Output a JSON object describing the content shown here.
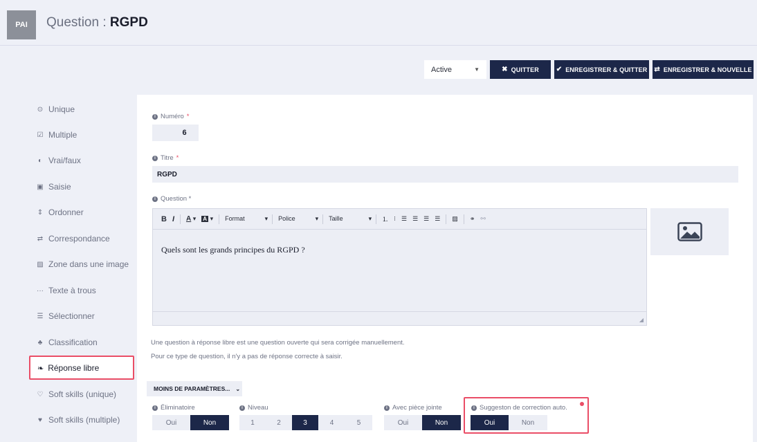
{
  "header": {
    "badge": "PAI",
    "title_prefix": "Question : ",
    "title_name": "RGPD"
  },
  "actions": {
    "status_value": "Active",
    "quit_label": "QUITTER",
    "save_quit_label": "ENREGISTRER & QUITTER",
    "save_new_label": "ENREGISTRER & NOUVELLE"
  },
  "sidebar": {
    "items": [
      {
        "label": "Unique",
        "icon": "radio-icon"
      },
      {
        "label": "Multiple",
        "icon": "checkbox-icon"
      },
      {
        "label": "Vrai/faux",
        "icon": "half-circle-icon"
      },
      {
        "label": "Saisie",
        "icon": "edit-icon"
      },
      {
        "label": "Ordonner",
        "icon": "sort-icon"
      },
      {
        "label": "Correspondance",
        "icon": "swap-icon"
      },
      {
        "label": "Zone dans une image",
        "icon": "image-icon"
      },
      {
        "label": "Texte à trous",
        "icon": "dots-icon"
      },
      {
        "label": "Sélectionner",
        "icon": "list-icon"
      },
      {
        "label": "Classification",
        "icon": "hierarchy-icon"
      },
      {
        "label": "Réponse libre",
        "icon": "leaf-icon"
      },
      {
        "label": "Soft skills (unique)",
        "icon": "heart-outline-icon"
      },
      {
        "label": "Soft skills (multiple)",
        "icon": "heart-icon"
      }
    ],
    "active_index": 10
  },
  "form": {
    "numero_label": "Numéro",
    "numero_value": "6",
    "titre_label": "Titre",
    "titre_value": "RGPD",
    "question_label": "Question *",
    "required_mark": "*",
    "toolbar": {
      "format": "Format",
      "police": "Police",
      "taille": "Taille"
    },
    "question_text": "Quels sont les grands principes du RGPD ?",
    "help_line1": "Une question à réponse libre est une question ouverte qui sera corrigée manuellement.",
    "help_line2": "Pour ce type de question, il n'y a pas de réponse correcte à saisir.",
    "more_params": "MOINS DE PARAMÈTRES..."
  },
  "params": {
    "eliminatoire": {
      "label": "Éliminatoire",
      "options": [
        "Oui",
        "Non"
      ],
      "selected": "Non"
    },
    "niveau": {
      "label": "Niveau",
      "options": [
        "1",
        "2",
        "3",
        "4",
        "5"
      ],
      "selected": "3"
    },
    "piece_jointe": {
      "label": "Avec pièce jointe",
      "options": [
        "Oui",
        "Non"
      ],
      "selected": "Non"
    },
    "suggestion": {
      "label": "Suggeston de correction auto.",
      "options": [
        "Oui",
        "Non"
      ],
      "selected": "Oui"
    }
  },
  "colors": {
    "navy": "#1c2749",
    "highlight": "#ea4d66",
    "background": "#eef0f7"
  }
}
